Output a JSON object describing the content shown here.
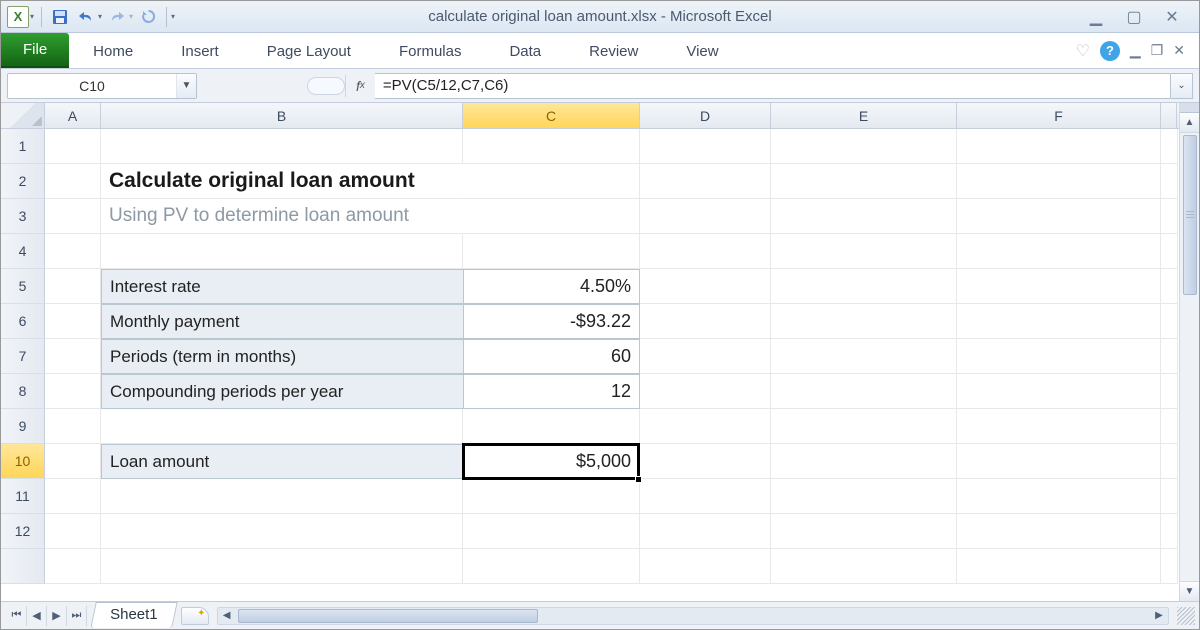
{
  "window": {
    "title": "calculate original loan amount.xlsx - Microsoft Excel"
  },
  "ribbon": {
    "file": "File",
    "tabs": [
      "Home",
      "Insert",
      "Page Layout",
      "Formulas",
      "Data",
      "Review",
      "View"
    ]
  },
  "nameBox": "C10",
  "formula": "=PV(C5/12,C7,C6)",
  "columns": [
    "A",
    "B",
    "C",
    "D",
    "E",
    "F"
  ],
  "rowNumbers": [
    "1",
    "2",
    "3",
    "4",
    "5",
    "6",
    "7",
    "8",
    "9",
    "10",
    "11",
    "12"
  ],
  "selected": {
    "row": "10",
    "col": "C"
  },
  "content": {
    "title": "Calculate original loan amount",
    "subtitle": "Using PV to determine loan amount",
    "rows": [
      {
        "label": "Interest rate",
        "value": "4.50%"
      },
      {
        "label": "Monthly payment",
        "value": "-$93.22"
      },
      {
        "label": "Periods (term in months)",
        "value": "60"
      },
      {
        "label": "Compounding periods per year",
        "value": "12"
      }
    ],
    "result": {
      "label": "Loan amount",
      "value": "$5,000"
    }
  },
  "sheetTab": "Sheet1"
}
